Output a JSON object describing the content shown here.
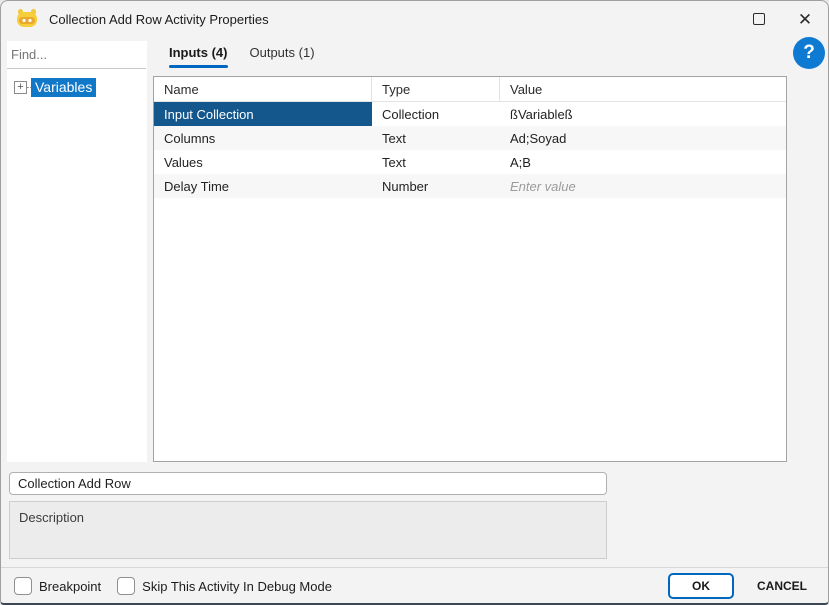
{
  "window": {
    "title": "Collection Add Row Activity Properties",
    "controls": {
      "maximize": "",
      "close": "✕"
    }
  },
  "help": {
    "label": "?"
  },
  "sidebar": {
    "find_placeholder": "Find...",
    "tree": [
      {
        "expander": "+",
        "label": "Variables",
        "selected": true
      }
    ]
  },
  "tabs": [
    {
      "label": "Inputs (4)",
      "active": true
    },
    {
      "label": "Outputs (1)",
      "active": false
    }
  ],
  "table": {
    "columns": [
      "Name",
      "Type",
      "Value"
    ],
    "rows": [
      {
        "name": "Input Collection",
        "type": "Collection",
        "value": "ßVariableß",
        "selected": true
      },
      {
        "name": "Columns",
        "type": "Text",
        "value": "Ad;Soyad",
        "selected": false
      },
      {
        "name": "Values",
        "type": "Text",
        "value": "A;B",
        "selected": false
      },
      {
        "name": "Delay Time",
        "type": "Number",
        "value": "",
        "placeholder": "Enter value",
        "selected": false
      }
    ]
  },
  "activity": {
    "name_value": "Collection Add Row",
    "description_text": "Description"
  },
  "footer": {
    "checkboxes": [
      {
        "label": "Breakpoint",
        "checked": false
      },
      {
        "label": "Skip This Activity In Debug Mode",
        "checked": false
      }
    ],
    "ok_label": "OK",
    "cancel_label": "CANCEL"
  },
  "colors": {
    "accent_blue": "#0067c0",
    "row_selection": "#14578c",
    "tree_selection": "#1178c8",
    "help_circle": "#0f7ad2",
    "dialog_bg": "#f3f3f3",
    "alt_row": "#f7f7f7"
  }
}
